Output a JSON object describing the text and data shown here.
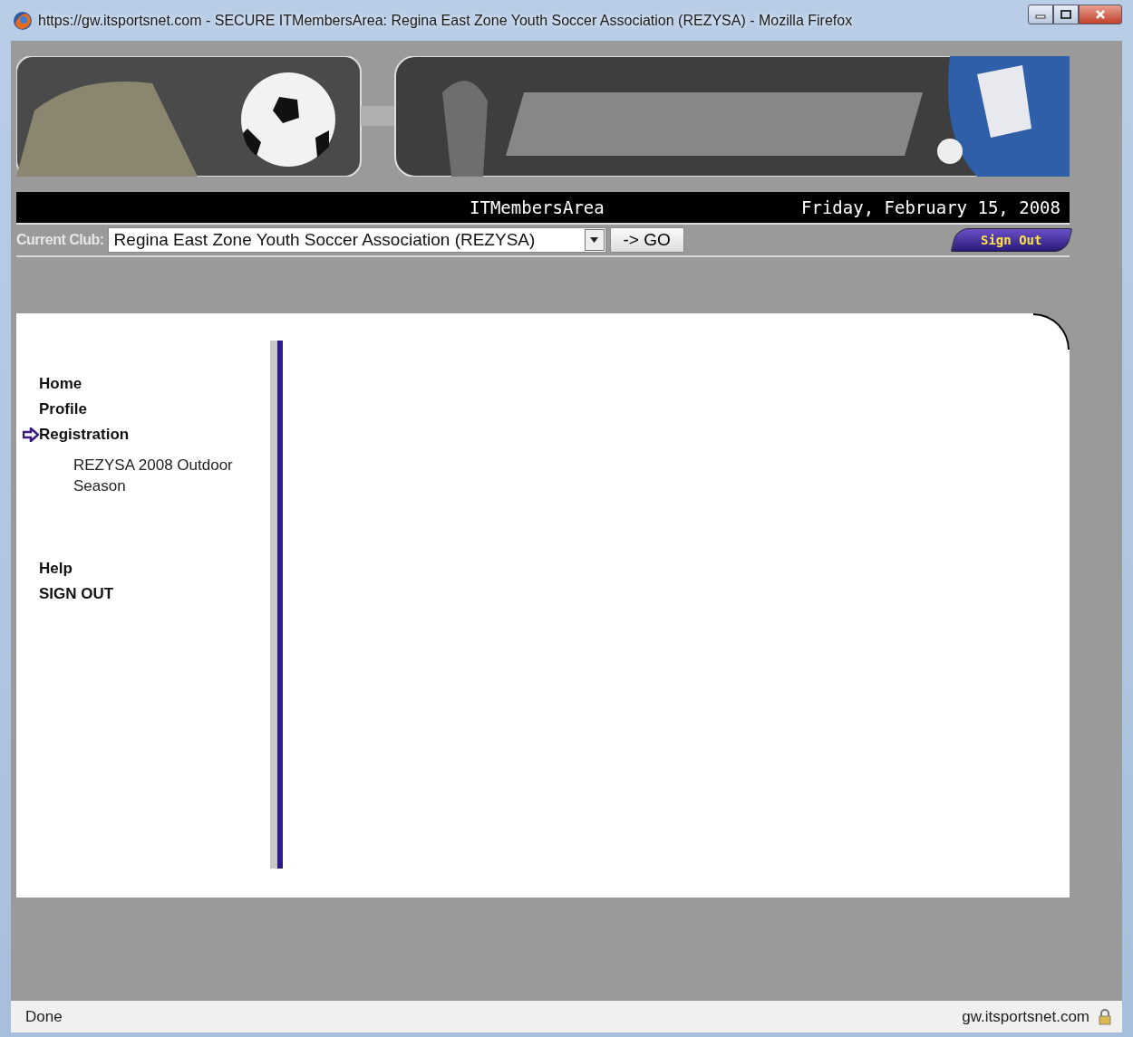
{
  "window": {
    "title": "https://gw.itsportsnet.com - SECURE ITMembersArea: Regina East Zone Youth Soccer Association (REZYSA) - Mozilla Firefox"
  },
  "header": {
    "site_name": "ITMembersArea",
    "date": "Friday, February 15, 2008"
  },
  "club_bar": {
    "label": "Current Club:",
    "club_select": {
      "value": "Regina East Zone Youth Soccer Association (REZYSA)"
    },
    "go_button": "-> GO",
    "sign_out_button": "Sign Out"
  },
  "sidebar": {
    "groups": [
      {
        "items": [
          {
            "label": "Home",
            "selected": false
          },
          {
            "label": "Profile",
            "selected": false
          },
          {
            "label": "Registration",
            "selected": true,
            "children": [
              {
                "label": "REZYSA 2008 Outdoor Season"
              }
            ]
          }
        ]
      },
      {
        "items": [
          {
            "label": "Help",
            "selected": false
          },
          {
            "label": "SIGN OUT",
            "selected": false
          }
        ]
      }
    ]
  },
  "status_bar": {
    "text": "Done",
    "host": "gw.itsportsnet.com"
  }
}
